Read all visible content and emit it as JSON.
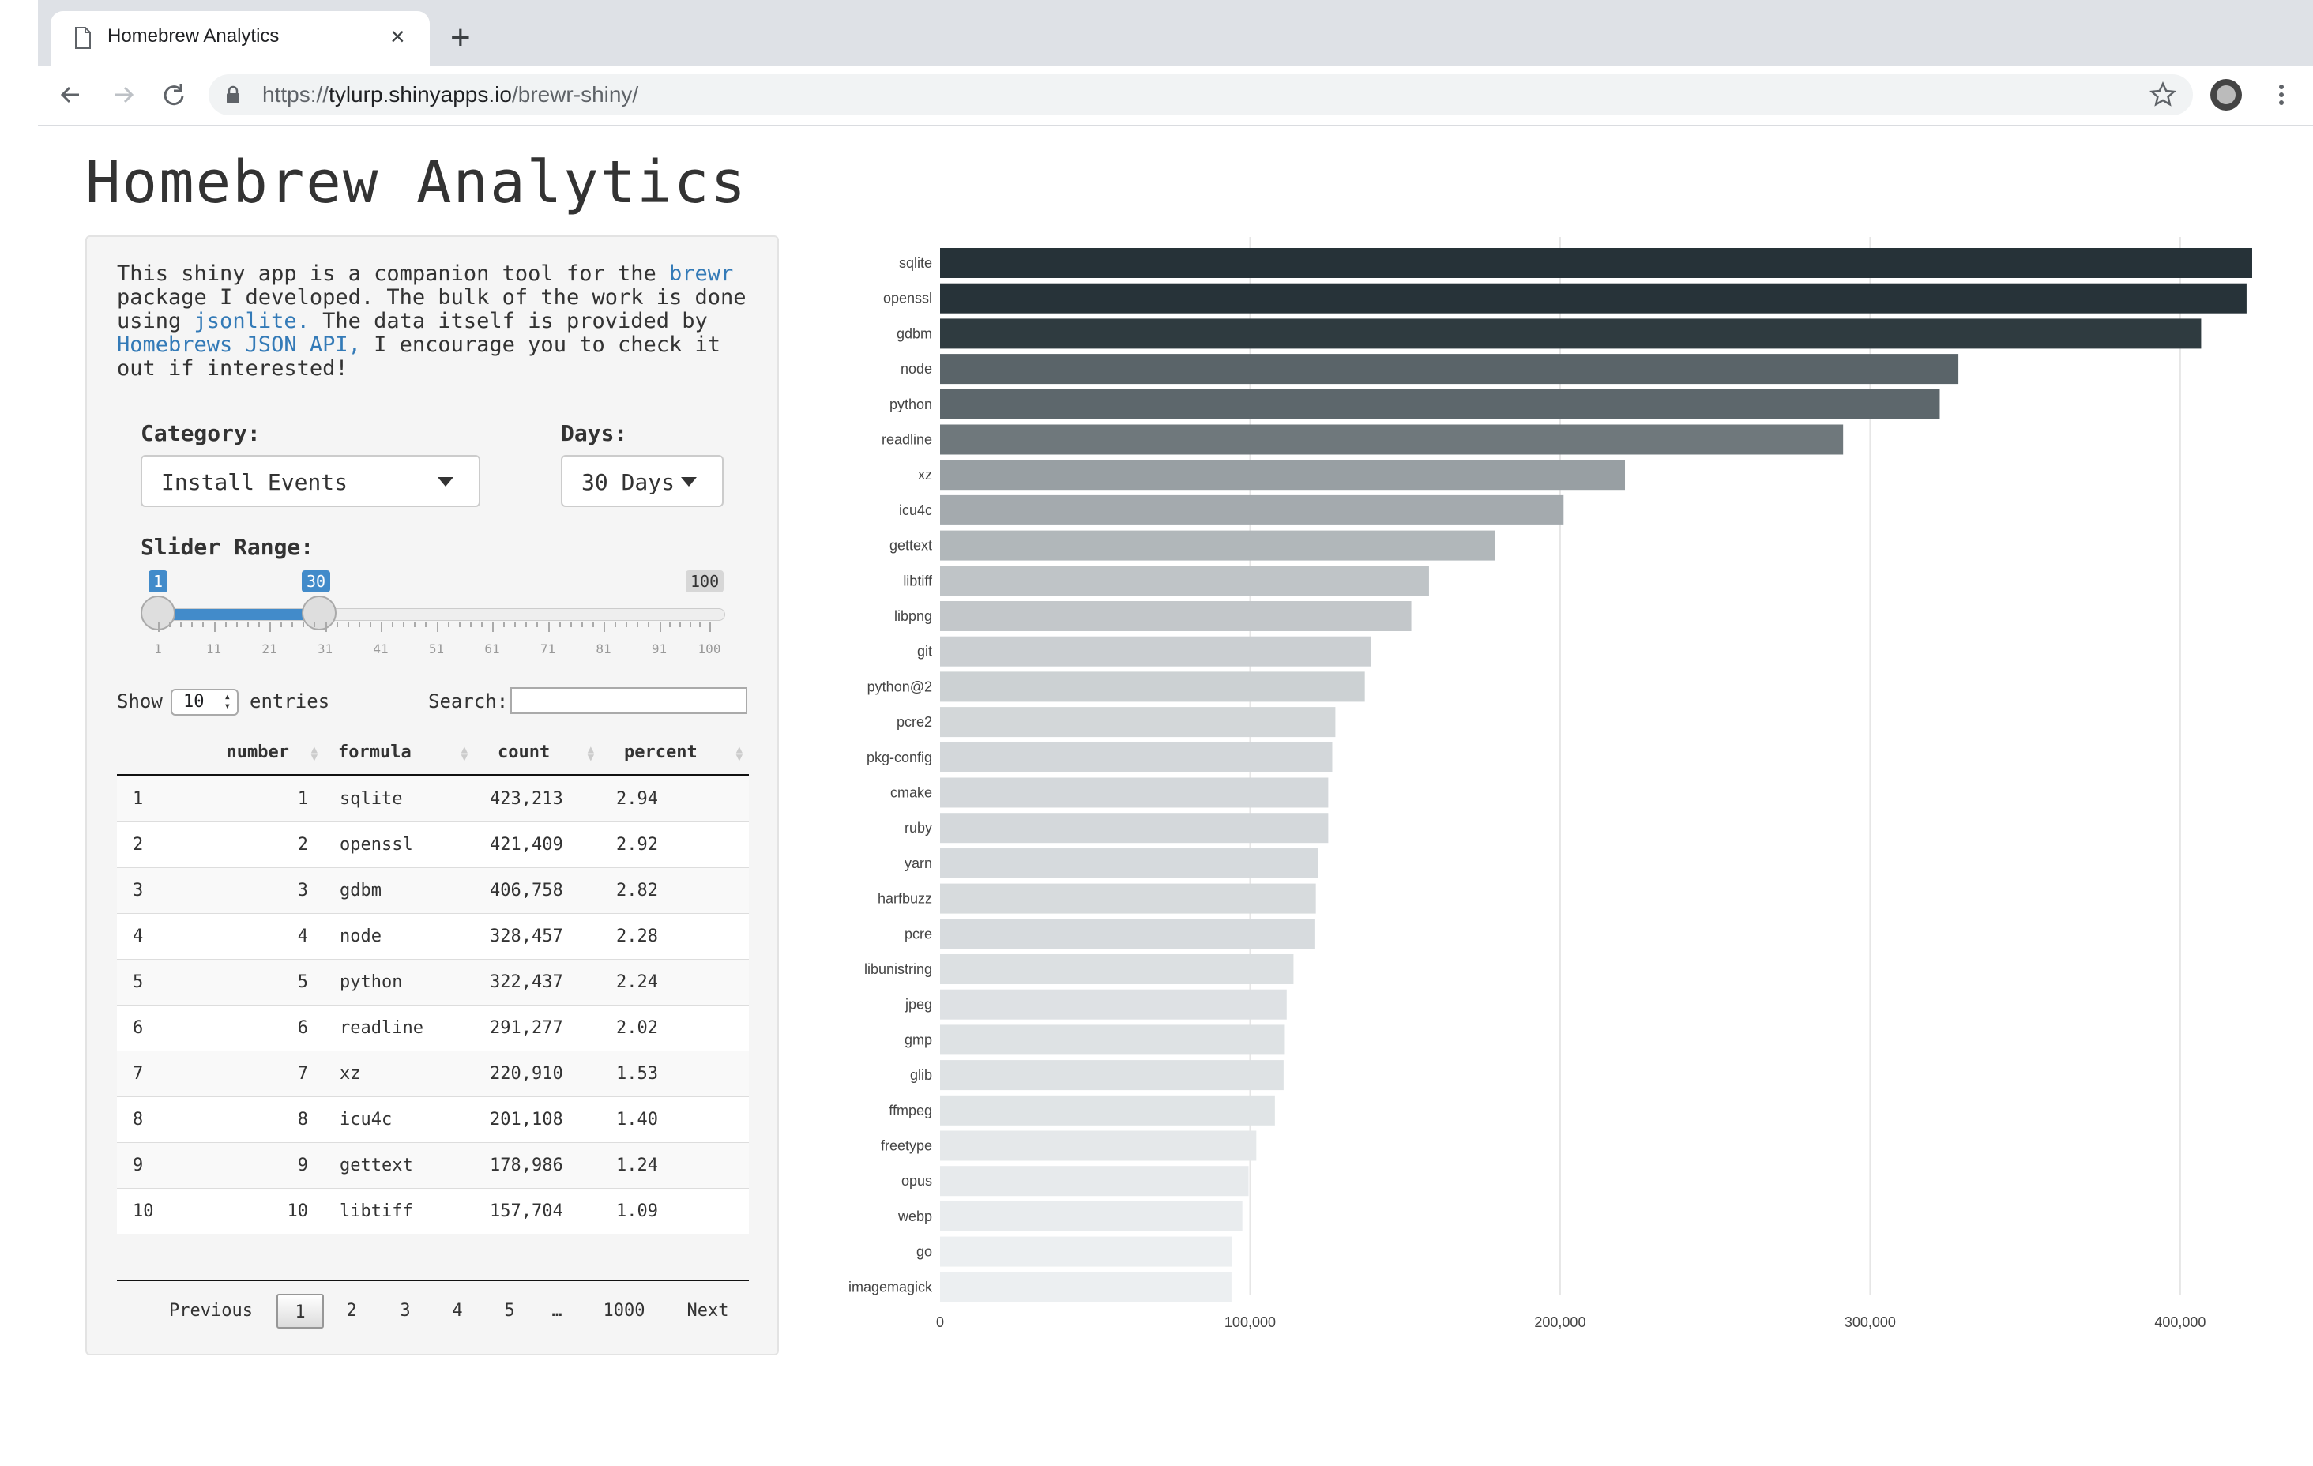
{
  "browser": {
    "tab_title": "Homebrew Analytics",
    "url_scheme": "https://",
    "url_host": "tylurp.shinyapps.io",
    "url_path": "/brewr-shiny/"
  },
  "page": {
    "title": "Homebrew Analytics",
    "intro": {
      "t1": "This shiny app is a companion tool for the ",
      "link1": "brewr",
      "t2": " package I developed. The bulk of the work is done using ",
      "link2": "jsonlite.",
      "t3": " The data itself is provided by ",
      "link3": "Homebrews JSON API,",
      "t4": " I encourage you to check it out if interested!"
    },
    "category": {
      "label": "Category:",
      "value": "Install Events"
    },
    "days": {
      "label": "Days:",
      "value": "30 Days"
    },
    "slider": {
      "label": "Slider Range:",
      "from": "1",
      "to": "30",
      "max": "100",
      "ticks": [
        "1",
        "11",
        "21",
        "31",
        "41",
        "51",
        "61",
        "71",
        "81",
        "91",
        "100"
      ]
    },
    "table_controls": {
      "show": "Show",
      "entries": "entries",
      "length_value": "10",
      "search_label": "Search:"
    },
    "table": {
      "columns": [
        "",
        "number",
        "formula",
        "count",
        "percent"
      ],
      "rows": [
        [
          "1",
          "1",
          "sqlite",
          "423,213",
          "2.94"
        ],
        [
          "2",
          "2",
          "openssl",
          "421,409",
          "2.92"
        ],
        [
          "3",
          "3",
          "gdbm",
          "406,758",
          "2.82"
        ],
        [
          "4",
          "4",
          "node",
          "328,457",
          "2.28"
        ],
        [
          "5",
          "5",
          "python",
          "322,437",
          "2.24"
        ],
        [
          "6",
          "6",
          "readline",
          "291,277",
          "2.02"
        ],
        [
          "7",
          "7",
          "xz",
          "220,910",
          "1.53"
        ],
        [
          "8",
          "8",
          "icu4c",
          "201,108",
          "1.40"
        ],
        [
          "9",
          "9",
          "gettext",
          "178,986",
          "1.24"
        ],
        [
          "10",
          "10",
          "libtiff",
          "157,704",
          "1.09"
        ]
      ]
    },
    "pagination": {
      "previous": "Previous",
      "pages": [
        "1",
        "2",
        "3",
        "4",
        "5",
        "…",
        "1000"
      ],
      "next": "Next",
      "current": "1"
    }
  },
  "colors": {
    "link": "#337ab7",
    "slider_accent": "#428bca",
    "bar_dark": "#263238",
    "bar_light": "#eceff1"
  },
  "chart_data": {
    "type": "bar",
    "orientation": "horizontal",
    "categories": [
      "sqlite",
      "openssl",
      "gdbm",
      "node",
      "python",
      "readline",
      "xz",
      "icu4c",
      "gettext",
      "libtiff",
      "libpng",
      "git",
      "python@2",
      "pcre2",
      "pkg-config",
      "cmake",
      "ruby",
      "yarn",
      "harfbuzz",
      "pcre",
      "libunistring",
      "jpeg",
      "gmp",
      "glib",
      "ffmpeg",
      "freetype",
      "opus",
      "webp",
      "go",
      "imagemagick"
    ],
    "values": [
      423213,
      421409,
      406758,
      328457,
      322437,
      291277,
      220910,
      201108,
      178986,
      157704,
      152000,
      139000,
      137000,
      127500,
      126500,
      125200,
      125200,
      122000,
      121200,
      121000,
      114000,
      111800,
      111200,
      110800,
      108000,
      102000,
      99500,
      97500,
      94200,
      94000
    ],
    "xticks": [
      "0",
      "100,000",
      "200,000",
      "300,000",
      "400,000"
    ],
    "xlim": [
      0,
      425000
    ],
    "grid": true,
    "title": "",
    "xlabel": "",
    "ylabel": ""
  }
}
